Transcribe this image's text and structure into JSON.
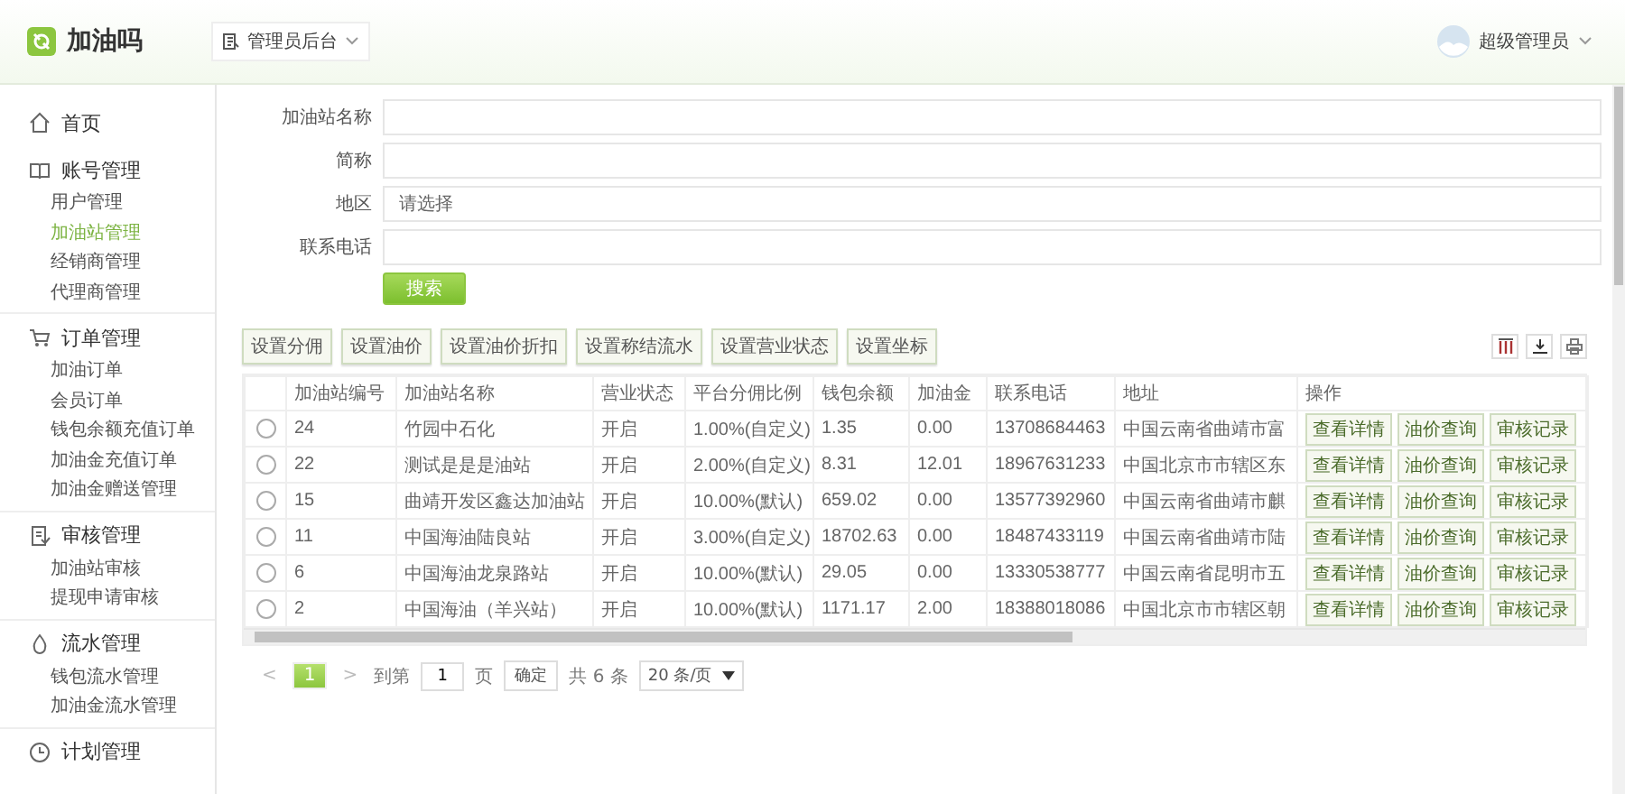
{
  "header": {
    "app_name": "加油吗",
    "role_switch": "管理员后台",
    "user": "超级管理员"
  },
  "sidebar": {
    "groups": [
      {
        "label": "首页"
      },
      {
        "label": "账号管理",
        "items": [
          {
            "label": "用户管理",
            "selected": false
          },
          {
            "label": "加油站管理",
            "selected": true
          },
          {
            "label": "经销商管理",
            "selected": false
          },
          {
            "label": "代理商管理",
            "selected": false
          }
        ]
      },
      {
        "label": "订单管理",
        "items": [
          {
            "label": "加油订单",
            "selected": false
          },
          {
            "label": "会员订单",
            "selected": false
          },
          {
            "label": "钱包余额充值订单",
            "selected": false
          },
          {
            "label": "加油金充值订单",
            "selected": false
          },
          {
            "label": "加油金赠送管理",
            "selected": false
          }
        ]
      },
      {
        "label": "审核管理",
        "items": [
          {
            "label": "加油站审核",
            "selected": false
          },
          {
            "label": "提现申请审核",
            "selected": false
          }
        ]
      },
      {
        "label": "流水管理",
        "items": [
          {
            "label": "钱包流水管理",
            "selected": false
          },
          {
            "label": "加油金流水管理",
            "selected": false
          }
        ]
      },
      {
        "label": "计划管理"
      }
    ]
  },
  "filters": [
    {
      "label": "加油站名称"
    },
    {
      "label": "简称"
    },
    {
      "label": "地区",
      "placeholder": "请选择"
    },
    {
      "label": "联系电话"
    }
  ],
  "search_button": "搜索",
  "actions": [
    "设置分佣",
    "设置油价",
    "设置油价折扣",
    "设置称结流水",
    "设置营业状态",
    "设置坐标"
  ],
  "table": {
    "columns": [
      "加油站编号",
      "加油站名称",
      "营业状态",
      "平台分佣比例",
      "钱包余额",
      "加油金",
      "联系电话",
      "地址",
      "操作"
    ],
    "rows": [
      {
        "selected": false,
        "cells": [
          "24",
          "竹园中石化",
          "开启",
          "1.00%(自定义)",
          "1.35",
          "0.00",
          "13708684463",
          "中国云南省曲靖市富"
        ],
        "actions": [
          "查看详情",
          "油价查询",
          "审核记录"
        ]
      },
      {
        "selected": false,
        "cells": [
          "22",
          "测试是是是油站",
          "开启",
          "2.00%(自定义)",
          "8.31",
          "12.01",
          "18967631233",
          "中国北京市市辖区东"
        ],
        "actions": [
          "查看详情",
          "油价查询",
          "审核记录"
        ]
      },
      {
        "selected": false,
        "cells": [
          "15",
          "曲靖开发区鑫达加油站",
          "开启",
          "10.00%(默认)",
          "659.02",
          "0.00",
          "13577392960",
          "中国云南省曲靖市麒"
        ],
        "actions": [
          "查看详情",
          "油价查询",
          "审核记录"
        ]
      },
      {
        "selected": false,
        "cells": [
          "11",
          "中国海油陆良站",
          "开启",
          "3.00%(自定义)",
          "18702.63",
          "0.00",
          "18487433119",
          "中国云南省曲靖市陆"
        ],
        "actions": [
          "查看详情",
          "油价查询",
          "审核记录"
        ]
      },
      {
        "selected": false,
        "cells": [
          "6",
          "中国海油龙泉路站",
          "开启",
          "10.00%(默认)",
          "29.05",
          "0.00",
          "13330538777",
          "中国云南省昆明市五"
        ],
        "actions": [
          "查看详情",
          "油价查询",
          "审核记录"
        ]
      },
      {
        "selected": false,
        "cells": [
          "2",
          "中国海油（羊兴站）",
          "开启",
          "10.00%(默认)",
          "1171.17",
          "2.00",
          "18388018086",
          "中国北京市市辖区朝"
        ],
        "actions": [
          "查看详情",
          "油价查询",
          "审核记录"
        ]
      }
    ]
  },
  "pagination": {
    "prev": "<",
    "pages": [
      {
        "label": "1",
        "selected": true
      }
    ],
    "next": ">",
    "goto_label": "到第",
    "goto_value": "1",
    "page_unit": "页",
    "confirm": "确定",
    "total": "共 6 条",
    "page_size": "20 条/页"
  }
}
